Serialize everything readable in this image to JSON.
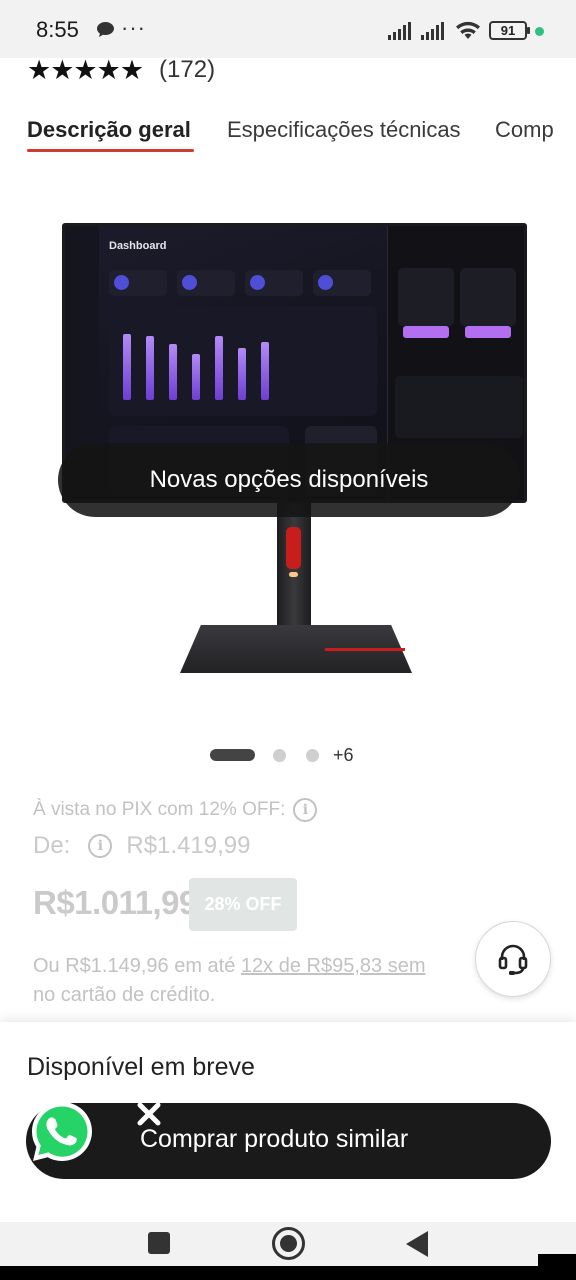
{
  "status_bar": {
    "time": "8:55",
    "dots": "···",
    "battery": "91",
    "icons": [
      "message-icon",
      "signal-icon",
      "signal-icon",
      "wifi-icon",
      "battery-icon",
      "notification-dot"
    ]
  },
  "rating": {
    "stars": "★★★★★",
    "count": "(172)"
  },
  "tabs": [
    {
      "label": "Descrição geral",
      "active": true
    },
    {
      "label": "Especificações técnicas",
      "active": false
    },
    {
      "label": "Comp",
      "active": false
    }
  ],
  "product_image": {
    "overlay_text": "Novas opções disponíveis",
    "screen_title": "Dashboard"
  },
  "carousel": {
    "more": "+6"
  },
  "pricing": {
    "pix_text": "À vista no PIX com 12% OFF:",
    "de_label": "De:",
    "original_price": "R$1.419,99",
    "price": "R$1.011,99",
    "discount": "28% OFF",
    "install_prefix": "Ou R$1.149,96 em até ",
    "install_link": "12x de R$95,83 sem",
    "install_suffix": "no cartão de crédito."
  },
  "bottom_sheet": {
    "availability": "Disponível em breve",
    "buy_similar": "Comprar produto similar"
  },
  "colors": {
    "tab_underline": "#cf3b2f",
    "button_bg": "#1a1a1a",
    "whatsapp": "#25d366"
  }
}
